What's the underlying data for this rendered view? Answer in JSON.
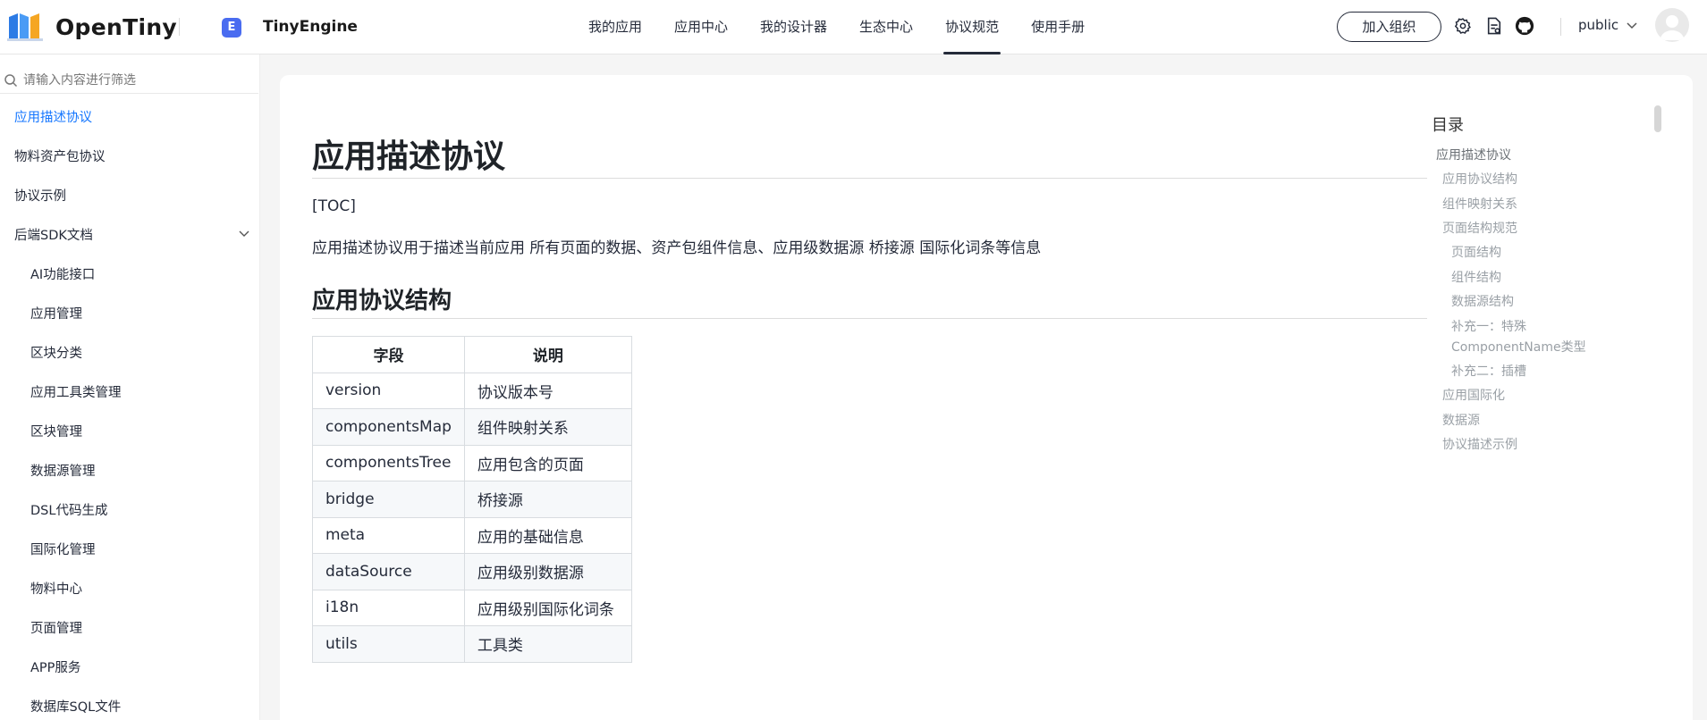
{
  "header": {
    "logo_text": "OpenTiny",
    "product_icon_letter": "E",
    "product_name": "TinyEngine",
    "nav": [
      {
        "label": "我的应用"
      },
      {
        "label": "应用中心"
      },
      {
        "label": "我的设计器"
      },
      {
        "label": "生态中心"
      },
      {
        "label": "协议规范",
        "active": true
      },
      {
        "label": "使用手册"
      }
    ],
    "join_button": "加入组织",
    "tenant": "public",
    "icons": [
      "gear-icon",
      "document-icon",
      "github-icon",
      "chevron-down-icon",
      "avatar"
    ]
  },
  "sidebar": {
    "search_placeholder": "请输入内容进行筛选",
    "items": [
      {
        "label": "应用描述协议",
        "active": true
      },
      {
        "label": "物料资产包协议"
      },
      {
        "label": "协议示例"
      },
      {
        "label": "后端SDK文档",
        "expandable": true
      },
      {
        "label": "AI功能接口",
        "sub": true
      },
      {
        "label": "应用管理",
        "sub": true
      },
      {
        "label": "区块分类",
        "sub": true
      },
      {
        "label": "应用工具类管理",
        "sub": true
      },
      {
        "label": "区块管理",
        "sub": true
      },
      {
        "label": "数据源管理",
        "sub": true
      },
      {
        "label": "DSL代码生成",
        "sub": true
      },
      {
        "label": "国际化管理",
        "sub": true
      },
      {
        "label": "物料中心",
        "sub": true
      },
      {
        "label": "页面管理",
        "sub": true
      },
      {
        "label": "APP服务",
        "sub": true
      },
      {
        "label": "数据库SQL文件",
        "sub": true
      }
    ]
  },
  "doc": {
    "title": "应用描述协议",
    "toc_tag": "[TOC]",
    "intro": "应用描述协议用于描述当前应用 所有页面的数据、资产包组件信息、应用级数据源 桥接源 国际化词条等信息",
    "section_title": "应用协议结构",
    "table": {
      "headers": [
        "字段",
        "说明"
      ],
      "rows": [
        [
          "version",
          "协议版本号"
        ],
        [
          "componentsMap",
          "组件映射关系"
        ],
        [
          "componentsTree",
          "应用包含的页面"
        ],
        [
          "bridge",
          "桥接源"
        ],
        [
          "meta",
          "应用的基础信息"
        ],
        [
          "dataSource",
          "应用级别数据源"
        ],
        [
          "i18n",
          "应用级别国际化词条"
        ],
        [
          "utils",
          "工具类"
        ]
      ]
    }
  },
  "toc": {
    "title": "目录",
    "items": [
      {
        "label": "应用描述协议",
        "level": 1
      },
      {
        "label": "应用协议结构",
        "level": 2
      },
      {
        "label": "组件映射关系",
        "level": 2
      },
      {
        "label": "页面结构规范",
        "level": 2
      },
      {
        "label": "页面结构",
        "level": 3
      },
      {
        "label": "组件结构",
        "level": 3
      },
      {
        "label": "数据源结构",
        "level": 3
      },
      {
        "label": "补充一：特殊",
        "level": 3
      },
      {
        "label": "ComponentName类型",
        "level": 3
      },
      {
        "label": "补充二：插槽",
        "level": 3
      },
      {
        "label": "应用国际化",
        "level": 2
      },
      {
        "label": "数据源",
        "level": 2
      },
      {
        "label": "协议描述示例",
        "level": 2
      }
    ]
  },
  "colors": {
    "accent": "#1476ff",
    "text": "#252b3a",
    "product_icon": "#4a6cf0"
  }
}
